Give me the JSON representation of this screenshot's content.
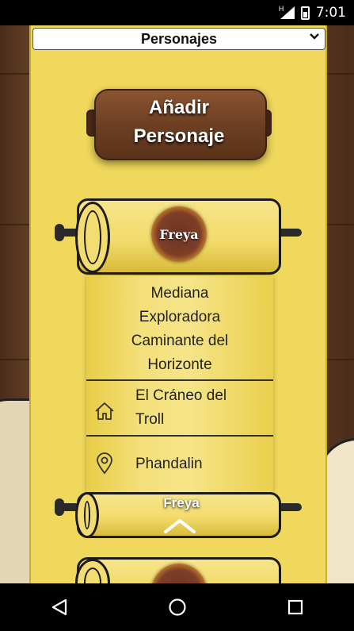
{
  "status_bar": {
    "time": "7:01",
    "network_mark": "H"
  },
  "selector": {
    "value": "Personajes"
  },
  "add_button": {
    "line1": "Añadir",
    "line2": "Personaje"
  },
  "character_card": {
    "name": "Freya",
    "description_lines": [
      "Mediana",
      "Exploradora",
      "Caminante del",
      "Horizonte"
    ],
    "home": {
      "icon": "home-icon",
      "lines": [
        "El Cráneo del",
        "Troll"
      ]
    },
    "location": {
      "icon": "map-pin-icon",
      "text": "Phandalin"
    },
    "bottom_label": "Freya"
  },
  "next_card": {
    "visible": "partial"
  },
  "nav": {
    "back": "back-icon",
    "home": "home-circle-icon",
    "recents": "recents-icon"
  },
  "colors": {
    "parchment": "#f0d85c",
    "wood": "#6e3f22",
    "bar": "#000000"
  }
}
